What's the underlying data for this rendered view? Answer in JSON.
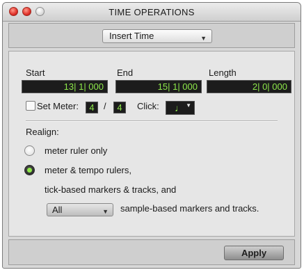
{
  "window": {
    "title": "TIME OPERATIONS"
  },
  "operation": {
    "selected": "Insert Time"
  },
  "fields": {
    "start_label": "Start",
    "start_value": "13| 1| 000",
    "end_label": "End",
    "end_value": "15| 1| 000",
    "length_label": "Length",
    "length_value": "2| 0| 000"
  },
  "meter": {
    "set_meter_label": "Set Meter:",
    "set_meter_checked": false,
    "numerator": "4",
    "separator": "/",
    "denominator": "4",
    "click_label": "Click:",
    "click_note_icon": "quarter-note-icon"
  },
  "realign": {
    "label": "Realign:",
    "option1": "meter ruler only",
    "option2_line1": "meter & tempo rulers,",
    "option2_line2": "tick-based markers & tracks, and",
    "sample_select_value": "All",
    "sample_text": "sample-based markers and tracks.",
    "selected_option": 2
  },
  "footer": {
    "apply_label": "Apply"
  },
  "colors": {
    "counter_bg": "#1c1c1c",
    "counter_text": "#8ee84a",
    "window_bg": "#d8d8d8"
  }
}
